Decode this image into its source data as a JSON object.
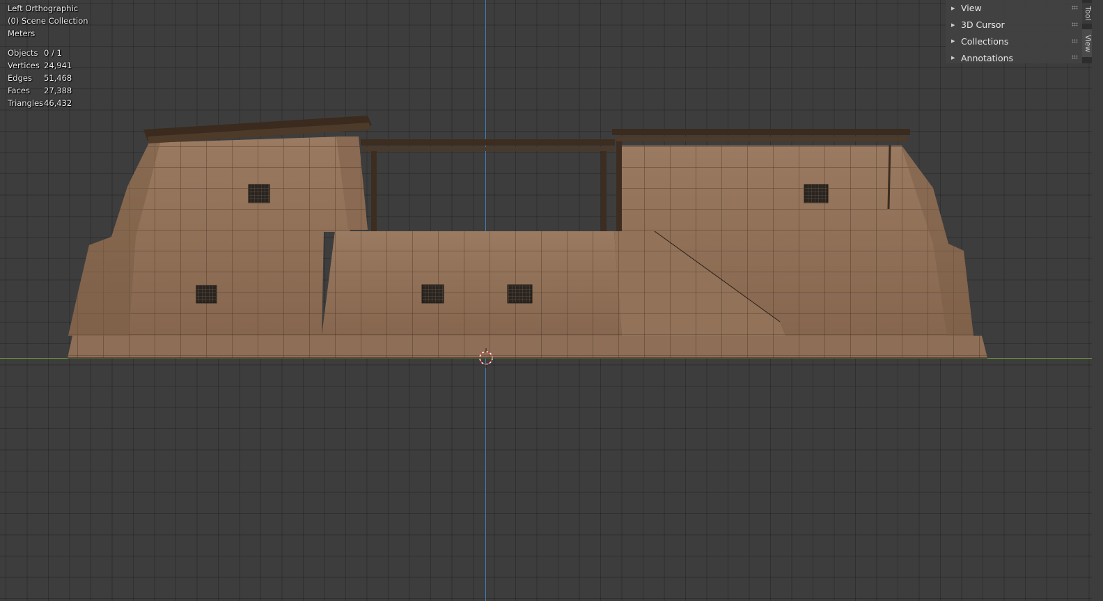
{
  "viewport": {
    "view_name": "Left Orthographic",
    "collection": "(0) Scene Collection",
    "units": "Meters"
  },
  "stats": [
    {
      "label": "Objects",
      "value": "0 / 1"
    },
    {
      "label": "Vertices",
      "value": "24,941"
    },
    {
      "label": "Edges",
      "value": "51,468"
    },
    {
      "label": "Faces",
      "value": "27,388"
    },
    {
      "label": "Triangles",
      "value": "46,432"
    }
  ],
  "sidebar": {
    "panels": [
      {
        "label": "View"
      },
      {
        "label": "3D Cursor"
      },
      {
        "label": "Collections"
      },
      {
        "label": "Annotations"
      }
    ],
    "tabs": [
      {
        "label": "Tool"
      },
      {
        "label": "View"
      }
    ]
  },
  "colors": {
    "background": "#3d3d3d",
    "axis_z": "#3f7fbf",
    "axis_y": "#6a9a3a",
    "wall": "#8d6d55",
    "wood": "#3c2d20"
  },
  "icons": [
    "disclosure-triangle-icon",
    "drag-grip-icon",
    "3d-cursor-icon"
  ]
}
